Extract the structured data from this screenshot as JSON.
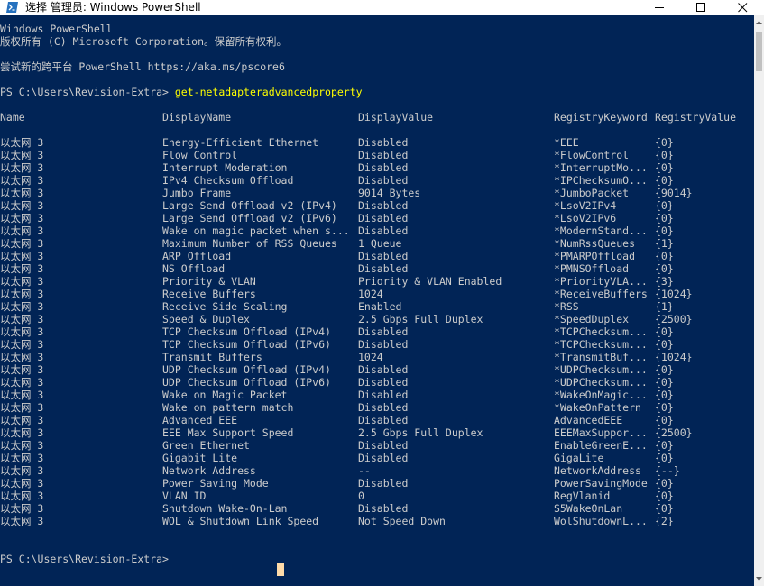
{
  "window": {
    "title": "选择 管理员: Windows PowerShell"
  },
  "console": {
    "banner_line1": "Windows PowerShell",
    "banner_line2": "版权所有 (C) Microsoft Corporation。保留所有权利。",
    "banner_line3": "尝试新的跨平台 PowerShell https://aka.ms/pscore6",
    "prompt": "PS C:\\Users\\Revision-Extra> ",
    "command": "get-netadapteradvancedproperty",
    "final_prompt": "PS C:\\Users\\Revision-Extra>"
  },
  "table": {
    "headers": {
      "name": "Name",
      "display_name": "DisplayName",
      "display_value": "DisplayValue",
      "registry_keyword": "RegistryKeyword",
      "registry_value": "RegistryValue"
    },
    "rows": [
      {
        "name": "以太网 3",
        "display_name": "Energy-Efficient Ethernet",
        "display_value": "Disabled",
        "registry_keyword": "*EEE",
        "registry_value": "{0}"
      },
      {
        "name": "以太网 3",
        "display_name": "Flow Control",
        "display_value": "Disabled",
        "registry_keyword": "*FlowControl",
        "registry_value": "{0}"
      },
      {
        "name": "以太网 3",
        "display_name": "Interrupt Moderation",
        "display_value": "Disabled",
        "registry_keyword": "*InterruptMo...",
        "registry_value": "{0}"
      },
      {
        "name": "以太网 3",
        "display_name": "IPv4 Checksum Offload",
        "display_value": "Disabled",
        "registry_keyword": "*IPChecksumO...",
        "registry_value": "{0}"
      },
      {
        "name": "以太网 3",
        "display_name": "Jumbo Frame",
        "display_value": "9014 Bytes",
        "registry_keyword": "*JumboPacket",
        "registry_value": "{9014}"
      },
      {
        "name": "以太网 3",
        "display_name": "Large Send Offload v2 (IPv4)",
        "display_value": "Disabled",
        "registry_keyword": "*LsoV2IPv4",
        "registry_value": "{0}"
      },
      {
        "name": "以太网 3",
        "display_name": "Large Send Offload v2 (IPv6)",
        "display_value": "Disabled",
        "registry_keyword": "*LsoV2IPv6",
        "registry_value": "{0}"
      },
      {
        "name": "以太网 3",
        "display_name": "Wake on magic packet when s...",
        "display_value": "Disabled",
        "registry_keyword": "*ModernStand...",
        "registry_value": "{0}"
      },
      {
        "name": "以太网 3",
        "display_name": "Maximum Number of RSS Queues",
        "display_value": "1 Queue",
        "registry_keyword": "*NumRssQueues",
        "registry_value": "{1}"
      },
      {
        "name": "以太网 3",
        "display_name": "ARP Offload",
        "display_value": "Disabled",
        "registry_keyword": "*PMARPOffload",
        "registry_value": "{0}"
      },
      {
        "name": "以太网 3",
        "display_name": "NS Offload",
        "display_value": "Disabled",
        "registry_keyword": "*PMNSOffload",
        "registry_value": "{0}"
      },
      {
        "name": "以太网 3",
        "display_name": "Priority & VLAN",
        "display_value": "Priority & VLAN Enabled",
        "registry_keyword": "*PriorityVLA...",
        "registry_value": "{3}"
      },
      {
        "name": "以太网 3",
        "display_name": "Receive Buffers",
        "display_value": "1024",
        "registry_keyword": "*ReceiveBuffers",
        "registry_value": "{1024}"
      },
      {
        "name": "以太网 3",
        "display_name": "Receive Side Scaling",
        "display_value": "Enabled",
        "registry_keyword": "*RSS",
        "registry_value": "{1}"
      },
      {
        "name": "以太网 3",
        "display_name": "Speed & Duplex",
        "display_value": "2.5 Gbps Full Duplex",
        "registry_keyword": "*SpeedDuplex",
        "registry_value": "{2500}"
      },
      {
        "name": "以太网 3",
        "display_name": "TCP Checksum Offload (IPv4)",
        "display_value": "Disabled",
        "registry_keyword": "*TCPChecksum...",
        "registry_value": "{0}"
      },
      {
        "name": "以太网 3",
        "display_name": "TCP Checksum Offload (IPv6)",
        "display_value": "Disabled",
        "registry_keyword": "*TCPChecksum...",
        "registry_value": "{0}"
      },
      {
        "name": "以太网 3",
        "display_name": "Transmit Buffers",
        "display_value": "1024",
        "registry_keyword": "*TransmitBuf...",
        "registry_value": "{1024}"
      },
      {
        "name": "以太网 3",
        "display_name": "UDP Checksum Offload (IPv4)",
        "display_value": "Disabled",
        "registry_keyword": "*UDPChecksum...",
        "registry_value": "{0}"
      },
      {
        "name": "以太网 3",
        "display_name": "UDP Checksum Offload (IPv6)",
        "display_value": "Disabled",
        "registry_keyword": "*UDPChecksum...",
        "registry_value": "{0}"
      },
      {
        "name": "以太网 3",
        "display_name": "Wake on Magic Packet",
        "display_value": "Disabled",
        "registry_keyword": "*WakeOnMagic...",
        "registry_value": "{0}"
      },
      {
        "name": "以太网 3",
        "display_name": "Wake on pattern match",
        "display_value": "Disabled",
        "registry_keyword": "*WakeOnPattern",
        "registry_value": "{0}"
      },
      {
        "name": "以太网 3",
        "display_name": "Advanced EEE",
        "display_value": "Disabled",
        "registry_keyword": "AdvancedEEE",
        "registry_value": "{0}"
      },
      {
        "name": "以太网 3",
        "display_name": "EEE Max Support Speed",
        "display_value": "2.5 Gbps Full Duplex",
        "registry_keyword": "EEEMaxSuppor...",
        "registry_value": "{2500}"
      },
      {
        "name": "以太网 3",
        "display_name": "Green Ethernet",
        "display_value": "Disabled",
        "registry_keyword": "EnableGreenE...",
        "registry_value": "{0}"
      },
      {
        "name": "以太网 3",
        "display_name": "Gigabit Lite",
        "display_value": "Disabled",
        "registry_keyword": "GigaLite",
        "registry_value": "{0}"
      },
      {
        "name": "以太网 3",
        "display_name": "Network Address",
        "display_value": "--",
        "registry_keyword": "NetworkAddress",
        "registry_value": "{--}"
      },
      {
        "name": "以太网 3",
        "display_name": "Power Saving Mode",
        "display_value": "Disabled",
        "registry_keyword": "PowerSavingMode",
        "registry_value": "{0}"
      },
      {
        "name": "以太网 3",
        "display_name": "VLAN ID",
        "display_value": "0",
        "registry_keyword": "RegVlanid",
        "registry_value": "{0}"
      },
      {
        "name": "以太网 3",
        "display_name": "Shutdown Wake-On-Lan",
        "display_value": "Disabled",
        "registry_keyword": "S5WakeOnLan",
        "registry_value": "{0}"
      },
      {
        "name": "以太网 3",
        "display_name": "WOL & Shutdown Link Speed",
        "display_value": "Not Speed Down",
        "registry_keyword": "WolShutdownL...",
        "registry_value": "{2}"
      }
    ]
  },
  "colors": {
    "console_background": "#012456",
    "console_text": "#cccccc",
    "command_text": "#ffff00",
    "cursor": "#fedba9",
    "titlebar_background": "#ffffff"
  },
  "icons": {
    "app": "powershell-icon",
    "minimize": "minimize-icon",
    "maximize": "maximize-icon",
    "close": "close-icon"
  }
}
